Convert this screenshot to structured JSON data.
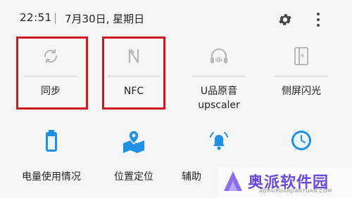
{
  "status": {
    "time": "22:51",
    "separator": "|",
    "date": "7月30日, 星期日"
  },
  "tiles_row1": [
    {
      "label": "同步",
      "icon": "sync-icon"
    },
    {
      "label": "NFC",
      "icon": "nfc-icon"
    },
    {
      "label": "U品原音",
      "sub": "upscaler",
      "icon": "headphones-icon"
    },
    {
      "label": "侧屏闪光",
      "icon": "edge-flash-icon"
    }
  ],
  "tiles_row2": [
    {
      "label": "电量使用情况",
      "icon": "battery-icon"
    },
    {
      "label": "位置定位",
      "icon": "location-map-icon"
    },
    {
      "label": "辅助",
      "icon": "bell-icon"
    },
    {
      "label": "",
      "icon": "clock-icon"
    }
  ],
  "watermark": {
    "text": "奥派软件园",
    "url": "AOPAIRUANJIANYUAN.COM"
  },
  "colors": {
    "highlight": "#d0191f",
    "blue_icon": "#1e90e6",
    "grey_icon": "#b7b7b7",
    "brand": "#6b4bd6"
  }
}
